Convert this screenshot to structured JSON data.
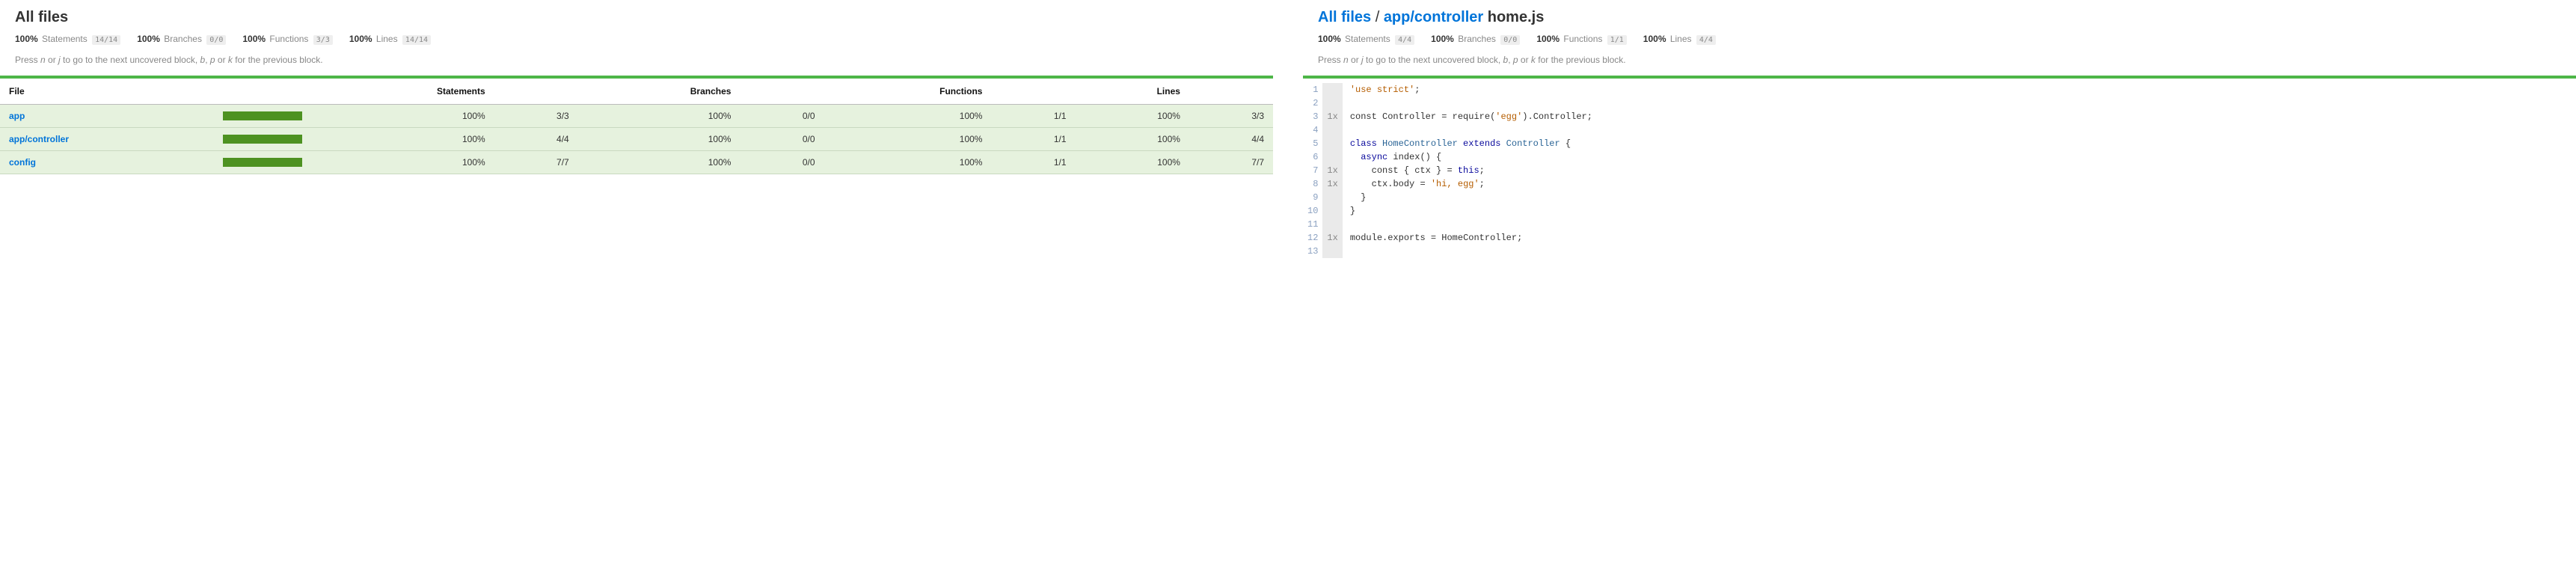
{
  "left": {
    "title": "All files",
    "stats": {
      "statements": {
        "pct": "100%",
        "label": "Statements",
        "frac": "14/14"
      },
      "branches": {
        "pct": "100%",
        "label": "Branches",
        "frac": "0/0"
      },
      "functions": {
        "pct": "100%",
        "label": "Functions",
        "frac": "3/3"
      },
      "lines": {
        "pct": "100%",
        "label": "Lines",
        "frac": "14/14"
      }
    },
    "hint_prefix": "Press ",
    "hint_key1": "n",
    "hint_mid1": " or ",
    "hint_key2": "j",
    "hint_mid2": " to go to the next uncovered block, ",
    "hint_key3": "b",
    "hint_mid3": ", ",
    "hint_key4": "p",
    "hint_mid4": " or ",
    "hint_key5": "k",
    "hint_end": " for the previous block.",
    "table": {
      "headers": {
        "file": "File",
        "statements": "Statements",
        "branches": "Branches",
        "functions": "Functions",
        "lines": "Lines"
      },
      "rows": [
        {
          "file": "app",
          "st_pct": "100%",
          "st_frac": "3/3",
          "br_pct": "100%",
          "br_frac": "0/0",
          "fn_pct": "100%",
          "fn_frac": "1/1",
          "ln_pct": "100%",
          "ln_frac": "3/3"
        },
        {
          "file": "app/controller",
          "st_pct": "100%",
          "st_frac": "4/4",
          "br_pct": "100%",
          "br_frac": "0/0",
          "fn_pct": "100%",
          "fn_frac": "1/1",
          "ln_pct": "100%",
          "ln_frac": "4/4"
        },
        {
          "file": "config",
          "st_pct": "100%",
          "st_frac": "7/7",
          "br_pct": "100%",
          "br_frac": "0/0",
          "fn_pct": "100%",
          "fn_frac": "1/1",
          "ln_pct": "100%",
          "ln_frac": "7/7"
        }
      ]
    }
  },
  "right": {
    "breadcrumb": {
      "root": "All files",
      "folder": "app/controller",
      "file": "home.js",
      "sep": " / "
    },
    "stats": {
      "statements": {
        "pct": "100%",
        "label": "Statements",
        "frac": "4/4"
      },
      "branches": {
        "pct": "100%",
        "label": "Branches",
        "frac": "0/0"
      },
      "functions": {
        "pct": "100%",
        "label": "Functions",
        "frac": "1/1"
      },
      "lines": {
        "pct": "100%",
        "label": "Lines",
        "frac": "4/4"
      }
    },
    "hint_prefix": "Press ",
    "hint_key1": "n",
    "hint_mid1": " or ",
    "hint_key2": "j",
    "hint_mid2": " to go to the next uncovered block, ",
    "hint_key3": "b",
    "hint_mid3": ", ",
    "hint_key4": "p",
    "hint_mid4": " or ",
    "hint_key5": "k",
    "hint_end": " for the previous block.",
    "code": {
      "line_numbers": [
        "1",
        "2",
        "3",
        "4",
        "5",
        "6",
        "7",
        "8",
        "9",
        "10",
        "11",
        "12",
        "13"
      ],
      "hits": [
        "",
        "",
        "1x",
        "",
        "",
        "",
        "1x",
        "1x",
        "",
        "",
        "",
        "1x",
        ""
      ],
      "source": [
        {
          "tokens": [
            {
              "t": "'use strict'",
              "c": "tok-str"
            },
            {
              "t": ";",
              "c": ""
            }
          ]
        },
        {
          "tokens": []
        },
        {
          "tokens": [
            {
              "t": "const ",
              "c": ""
            },
            {
              "t": "Controller",
              "c": "tok-fn"
            },
            {
              "t": " = ",
              "c": ""
            },
            {
              "t": "require",
              "c": "tok-fn"
            },
            {
              "t": "(",
              "c": ""
            },
            {
              "t": "'egg'",
              "c": "tok-str"
            },
            {
              "t": ").",
              "c": ""
            },
            {
              "t": "Controller",
              "c": "tok-fn"
            },
            {
              "t": ";",
              "c": ""
            }
          ]
        },
        {
          "tokens": []
        },
        {
          "tokens": [
            {
              "t": "class ",
              "c": "tok-kw"
            },
            {
              "t": "HomeController",
              "c": "tok-cls"
            },
            {
              "t": " extends ",
              "c": "tok-kw"
            },
            {
              "t": "Controller",
              "c": "tok-cls"
            },
            {
              "t": " {",
              "c": ""
            }
          ]
        },
        {
          "tokens": [
            {
              "t": "  async ",
              "c": "tok-kw"
            },
            {
              "t": "index",
              "c": "tok-fn"
            },
            {
              "t": "() {",
              "c": ""
            }
          ]
        },
        {
          "tokens": [
            {
              "t": "    const { ",
              "c": ""
            },
            {
              "t": "ctx",
              "c": ""
            },
            {
              "t": " } = ",
              "c": ""
            },
            {
              "t": "this",
              "c": "tok-this"
            },
            {
              "t": ";",
              "c": ""
            }
          ]
        },
        {
          "tokens": [
            {
              "t": "    ",
              "c": ""
            },
            {
              "t": "ctx",
              "c": ""
            },
            {
              "t": ".",
              "c": ""
            },
            {
              "t": "body",
              "c": ""
            },
            {
              "t": " = ",
              "c": ""
            },
            {
              "t": "'hi, egg'",
              "c": "tok-str"
            },
            {
              "t": ";",
              "c": ""
            }
          ]
        },
        {
          "tokens": [
            {
              "t": "  }",
              "c": ""
            }
          ]
        },
        {
          "tokens": [
            {
              "t": "}",
              "c": ""
            }
          ]
        },
        {
          "tokens": []
        },
        {
          "tokens": [
            {
              "t": "module",
              "c": ""
            },
            {
              "t": ".",
              "c": ""
            },
            {
              "t": "exports",
              "c": ""
            },
            {
              "t": " = ",
              "c": ""
            },
            {
              "t": "HomeController",
              "c": "tok-fn"
            },
            {
              "t": ";",
              "c": ""
            }
          ]
        },
        {
          "tokens": []
        }
      ]
    }
  }
}
